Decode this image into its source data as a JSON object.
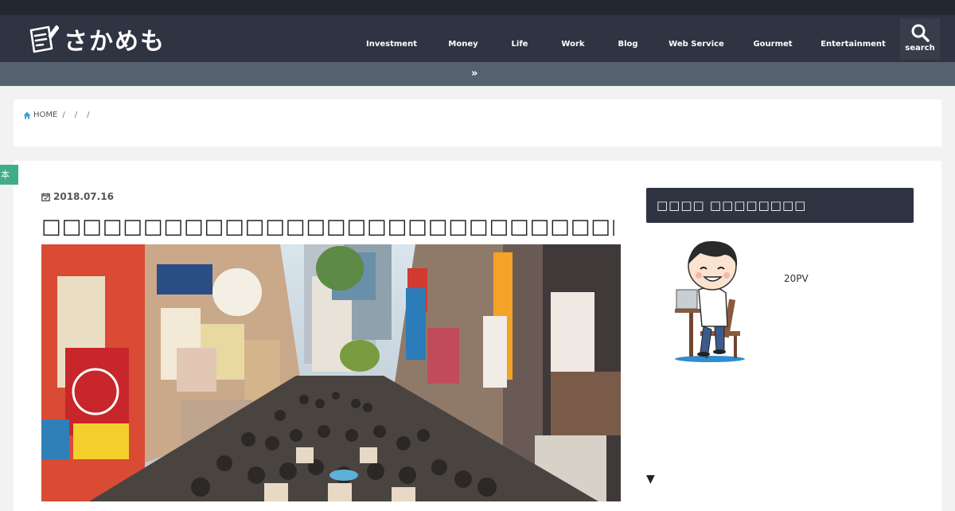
{
  "header": {
    "logo_text": "さかめも",
    "nav": [
      {
        "label": "Investment"
      },
      {
        "label": "Money"
      },
      {
        "label": "Life"
      },
      {
        "label": "Work"
      },
      {
        "label": "Blog"
      },
      {
        "label": "Web Service"
      },
      {
        "label": "Gourmet"
      },
      {
        "label": "Entertainment"
      }
    ],
    "search_label": "search"
  },
  "subbar": {
    "icon": "double-chevron-right-icon"
  },
  "breadcrumb": {
    "home_label": "HOME",
    "sep1": "/",
    "sep2": "/",
    "sep3": "/"
  },
  "side_tab": {
    "label": "本"
  },
  "post": {
    "date": "2018.07.16",
    "title": "□□□□□□□□□□□□□□□□□□□□□□□□□□□□□□ □□□□□□",
    "hero_image": "crowded-shopping-street-photo"
  },
  "sidebar": {
    "widget_title": "□□□□ □□□□□□□□",
    "pv_text": "20PV",
    "arrow": "▼"
  },
  "colors": {
    "header_bg": "#2e3441",
    "topstrip_bg": "#232830",
    "subbar_bg": "#566170",
    "accent_green": "#3fae86",
    "home_icon": "#3ea0d6"
  }
}
